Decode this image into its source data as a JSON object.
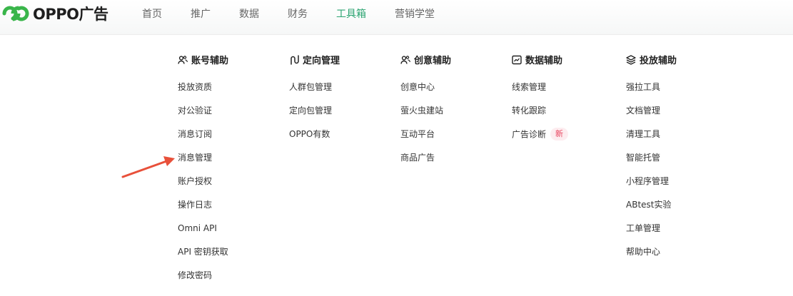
{
  "brand": {
    "name": "OPPO广告",
    "accent": "#2ba471",
    "logo_color": "#39b54a"
  },
  "nav": {
    "items": [
      "首页",
      "推广",
      "数据",
      "财务",
      "工具箱",
      "营销学堂"
    ],
    "active": "工具箱"
  },
  "menu": {
    "columns": [
      {
        "title": "账号辅助",
        "icon": "users-icon",
        "items": [
          "投放资质",
          "对公验证",
          "消息订阅",
          "消息管理",
          "账户授权",
          "操作日志",
          "Omni API",
          "API 密钥获取",
          "修改密码"
        ]
      },
      {
        "title": "定向管理",
        "icon": "route-icon",
        "items": [
          "人群包管理",
          "定向包管理",
          "OPPO有数"
        ]
      },
      {
        "title": "创意辅助",
        "icon": "users-icon",
        "items": [
          "创意中心",
          "萤火虫建站",
          "互动平台",
          "商品广告"
        ]
      },
      {
        "title": "数据辅助",
        "icon": "line-chart-icon",
        "items": [
          "线索管理",
          "转化跟踪",
          "广告诊断"
        ],
        "badge": {
          "text": "新",
          "color": "#e8445e",
          "background": "#fdecef"
        }
      },
      {
        "title": "投放辅助",
        "icon": "layers-icon",
        "items": [
          "强拉工具",
          "文档管理",
          "清理工具",
          "智能托管",
          "小程序管理",
          "ABtest实验",
          "工单管理",
          "帮助中心"
        ]
      }
    ]
  },
  "annotation": {
    "color": "#e8503a",
    "points_to": "消息管理"
  }
}
